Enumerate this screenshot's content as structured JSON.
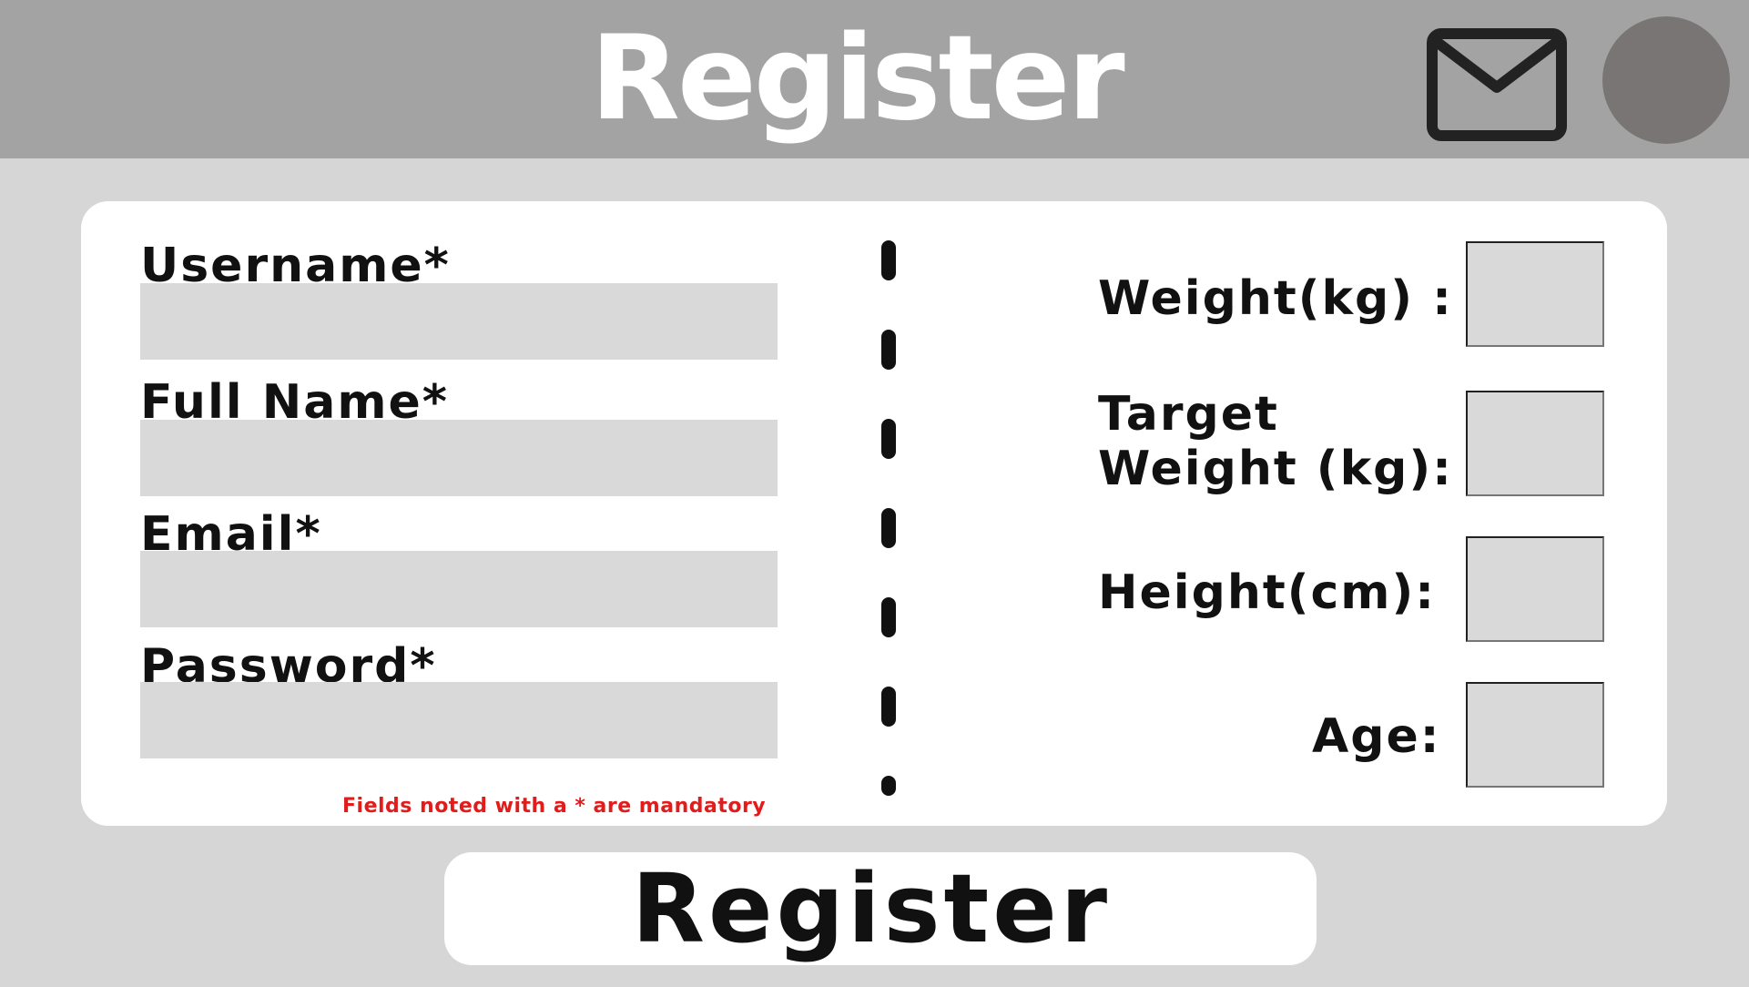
{
  "header": {
    "title": "Register",
    "mail_icon": "envelope-icon",
    "avatar_color": "#797574"
  },
  "form": {
    "left_fields": [
      {
        "label": "Username*",
        "value": ""
      },
      {
        "label": "Full Name*",
        "value": ""
      },
      {
        "label": "Email*",
        "value": ""
      },
      {
        "label": "Password*",
        "value": ""
      }
    ],
    "mandatory_note": "Fields noted with a * are mandatory",
    "right_fields": {
      "weight": {
        "label": "Weight(kg) :",
        "value": ""
      },
      "target_weight": {
        "label_line1": "Target",
        "label_line2": "Weight (kg):",
        "value": ""
      },
      "height": {
        "label": "Height(cm):",
        "value": ""
      },
      "age": {
        "label": "Age:",
        "value": ""
      }
    }
  },
  "actions": {
    "register_label": "Register"
  },
  "colors": {
    "header_bg": "#a3a3a3",
    "page_bg": "#d6d6d6",
    "input_bg": "#d9d9d9",
    "note_red": "#e21b1b"
  }
}
